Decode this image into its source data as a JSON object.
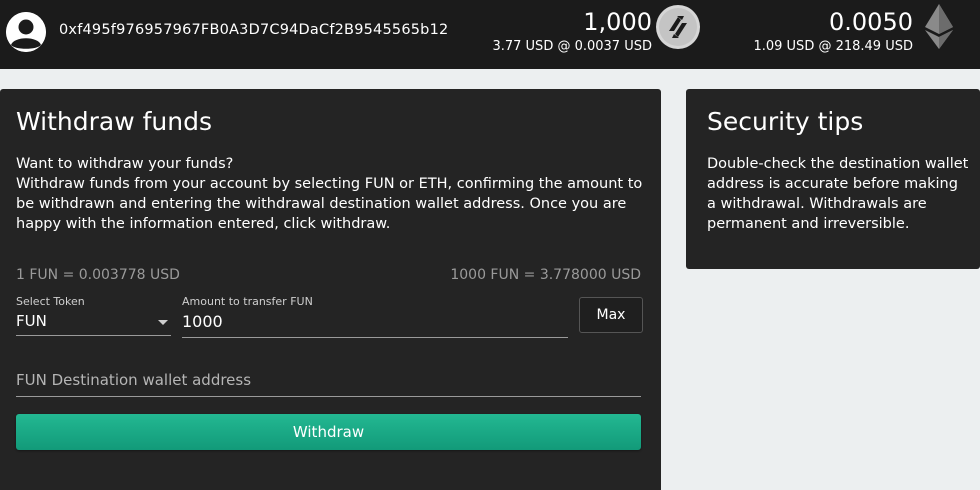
{
  "header": {
    "wallet_address": "0xf495f976957967FB0A3D7C94DaCf2B9545565b12",
    "balances": [
      {
        "token": "FUN",
        "amount": "1,000",
        "fiat": "3.77 USD @ 0.0037 USD",
        "icon": "funfair-coin-icon"
      },
      {
        "token": "ETH",
        "amount": "0.0050",
        "fiat": "1.09 USD @ 218.49 USD",
        "icon": "ethereum-icon"
      }
    ]
  },
  "withdraw": {
    "title": "Withdraw funds",
    "intro_heading": "Want to withdraw your funds?",
    "intro_text": "Withdraw funds from your account by selecting FUN or ETH, confirming the amount to be withdrawn and entering the withdrawal destination wallet address. Once you are happy with the information entered, click withdraw.",
    "rate_left": "1 FUN = 0.003778 USD",
    "rate_right": "1000 FUN = 3.778000 USD",
    "token_label": "Select Token",
    "token_value": "FUN",
    "amount_label": "Amount to transfer FUN",
    "amount_value": "1000",
    "max_label": "Max",
    "destination_placeholder": "FUN Destination wallet address",
    "withdraw_label": "Withdraw"
  },
  "security": {
    "title": "Security tips",
    "text": "Double-check the destination wallet address is accurate before making a withdrawal. Withdrawals are permanent and irreversible."
  },
  "colors": {
    "topbar": "#1b1b1b",
    "panel": "#242424",
    "page_background": "#eceff0",
    "accent": "#1aa884"
  }
}
